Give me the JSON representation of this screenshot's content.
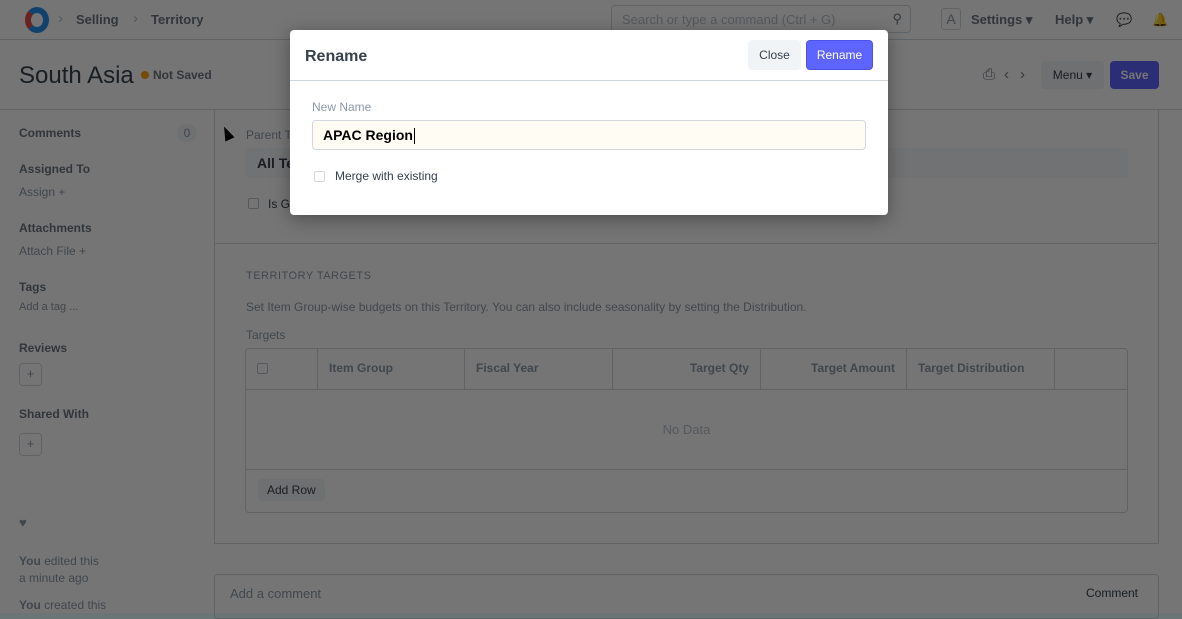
{
  "navbar": {
    "breadcrumbs": [
      "Selling",
      "Territory"
    ],
    "search_placeholder": "Search or type a command (Ctrl + G)",
    "avatar": "A",
    "settings": "Settings",
    "help": "Help"
  },
  "page": {
    "title": "South Asia",
    "status": "Not Saved",
    "menu": "Menu",
    "save": "Save"
  },
  "sidebar": {
    "comments": "Comments",
    "comments_count": "0",
    "assigned_to": "Assigned To",
    "assign": "Assign",
    "attachments": "Attachments",
    "attach_file": "Attach File",
    "tags": "Tags",
    "add_tag": "Add a tag ...",
    "reviews": "Reviews",
    "shared_with": "Shared With",
    "activity": [
      {
        "who": "You",
        "text": "edited this",
        "when": "a minute ago"
      },
      {
        "who": "You",
        "text": "created this"
      }
    ]
  },
  "form": {
    "parent_label": "Parent Territory",
    "parent_value": "All Territories",
    "is_group": "Is Group",
    "section_title": "TERRITORY TARGETS",
    "section_desc": "Set Item Group-wise budgets on this Territory. You can also include seasonality by setting the Distribution.",
    "targets_label": "Targets",
    "columns": [
      "Item Group",
      "Fiscal Year",
      "Target Qty",
      "Target Amount",
      "Target Distribution"
    ],
    "no_data": "No Data",
    "add_row": "Add Row"
  },
  "comment": {
    "placeholder": "Add a comment",
    "button": "Comment"
  },
  "dialog": {
    "title": "Rename",
    "close": "Close",
    "rename": "Rename",
    "new_name_label": "New Name",
    "new_name_value": "APAC Region",
    "merge_label": "Merge with existing",
    "merge_checked": false
  }
}
